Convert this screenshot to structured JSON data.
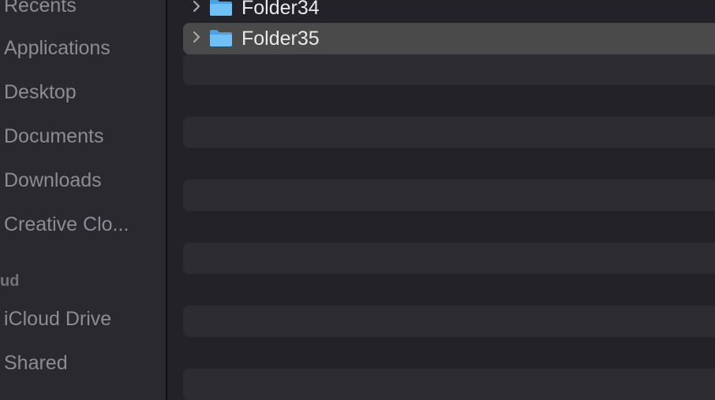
{
  "sidebar": {
    "favorites": [
      {
        "label": "Recents"
      },
      {
        "label": "Applications"
      },
      {
        "label": "Desktop"
      },
      {
        "label": "Documents"
      },
      {
        "label": "Downloads"
      },
      {
        "label": "Creative Clo..."
      }
    ],
    "icloud_header": "ud",
    "icloud": [
      {
        "label": "iCloud Drive"
      },
      {
        "label": "Shared"
      }
    ]
  },
  "list": {
    "rows": [
      {
        "name": "Folder34",
        "icon": "folder-icon",
        "expand_icon": "chevron-right-icon",
        "selected": false
      },
      {
        "name": "Folder35",
        "icon": "folder-icon",
        "expand_icon": "chevron-right-icon",
        "selected": true
      }
    ]
  },
  "colors": {
    "folder": "#5fb6ef",
    "selection": "#4a4a4b",
    "sidebar_bg": "#2a2930",
    "list_bg": "#232228",
    "stripe": "#2d2c33"
  }
}
